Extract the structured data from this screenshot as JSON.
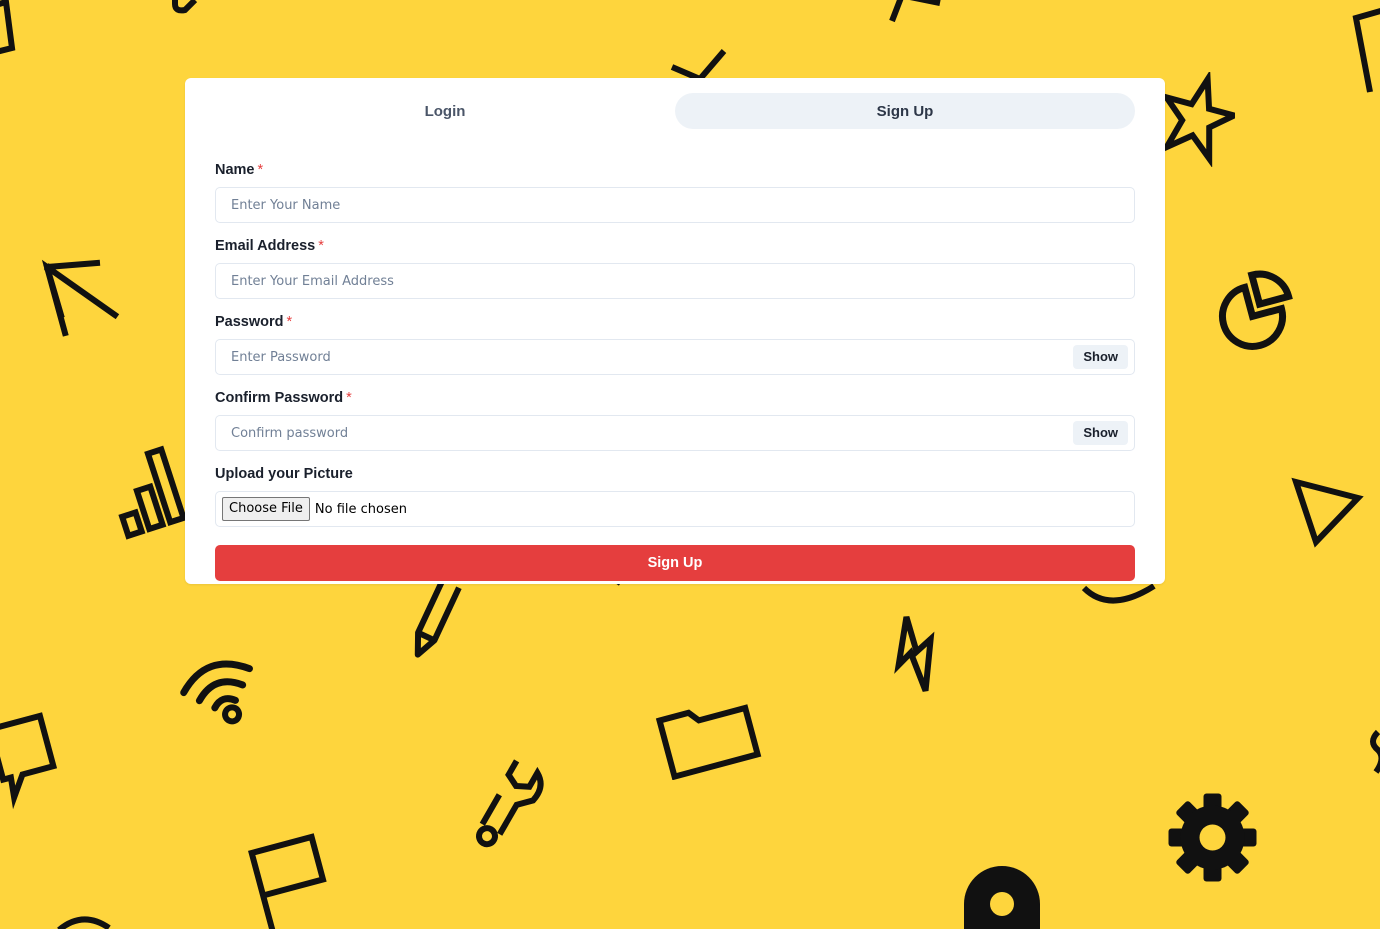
{
  "theme": {
    "background": "#FED53D",
    "accent": "#E53E3E",
    "tab_active_bg": "#EDF2F7",
    "icon_stroke": "#111111"
  },
  "tabs": [
    {
      "label": "Login",
      "active": false
    },
    {
      "label": "Sign Up",
      "active": true
    }
  ],
  "form": {
    "required_mark": "*",
    "name": {
      "label": "Name",
      "placeholder": "Enter Your Name",
      "value": ""
    },
    "email": {
      "label": "Email Address",
      "placeholder": "Enter Your Email Address",
      "value": ""
    },
    "password": {
      "label": "Password",
      "placeholder": "Enter Password",
      "value": "",
      "toggle_label": "Show"
    },
    "confirm": {
      "label": "Confirm Password",
      "placeholder": "Confirm password",
      "value": "",
      "toggle_label": "Show"
    },
    "picture": {
      "label": "Upload your Picture",
      "button_label": "Choose File",
      "status": "No file chosen"
    },
    "submit_label": "Sign Up"
  },
  "background_icons": [
    "square-icon",
    "arrow-up-left-icon",
    "bar-chart-icon",
    "pencil-icon",
    "wifi-icon",
    "chat-bubble-icon",
    "flag-icon",
    "wrench-icon",
    "folder-icon",
    "lightning-icon",
    "star-icon",
    "pie-chart-icon",
    "triangle-icon",
    "gear-icon",
    "location-pin-icon"
  ]
}
